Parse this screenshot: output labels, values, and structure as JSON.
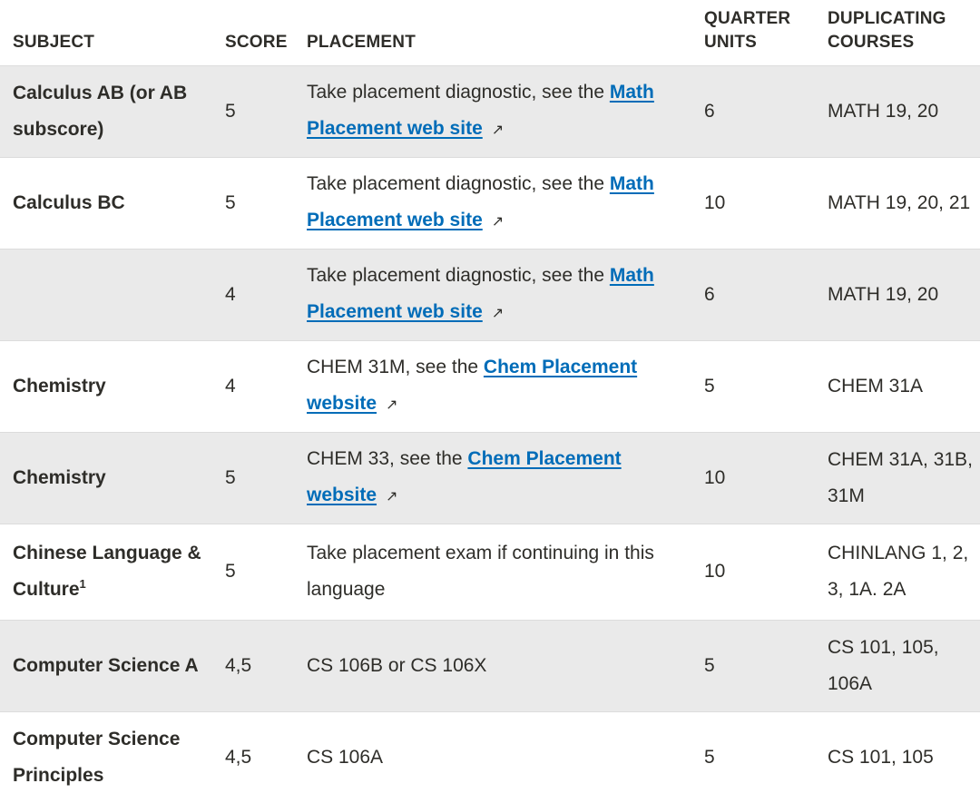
{
  "headers": {
    "subject": "SUBJECT",
    "score": "SCORE",
    "placement": "PLACEMENT",
    "units_line1": "QUARTER",
    "units_line2": "UNITS",
    "dup_line1": "DUPLICATING",
    "dup_line2": "COURSES"
  },
  "rows": [
    {
      "subject": "Calculus AB (or AB subscore)",
      "score": "5",
      "placement_prefix": "Take placement diagnostic, see the ",
      "placement_link": "Math Placement web site",
      "units": "6",
      "duplicating": "MATH 19, 20"
    },
    {
      "subject": "Calculus BC",
      "score": "5",
      "placement_prefix": "Take placement diagnostic, see the ",
      "placement_link": "Math Placement web site",
      "units": "10",
      "duplicating": "MATH 19, 20, 21"
    },
    {
      "subject": "",
      "score": "4",
      "placement_prefix": "Take placement diagnostic, see the ",
      "placement_link": "Math Placement web site",
      "units": "6",
      "duplicating": "MATH 19, 20"
    },
    {
      "subject": "Chemistry",
      "score": "4",
      "placement_prefix": "CHEM 31M, see the ",
      "placement_link": "Chem Placement website",
      "units": "5",
      "duplicating": "CHEM 31A"
    },
    {
      "subject": "Chemistry",
      "score": "5",
      "placement_prefix": "CHEM 33, see the ",
      "placement_link": "Chem Placement website",
      "units": "10",
      "duplicating": "CHEM 31A, 31B, 31M"
    },
    {
      "subject": "Chinese Language & Culture",
      "subject_sup": "1",
      "score": "5",
      "placement_text": "Take placement exam if continuing in this language",
      "units": "10",
      "duplicating": "CHINLANG 1, 2, 3, 1A. 2A"
    },
    {
      "subject": "Computer Science A",
      "score": "4,5",
      "placement_text": "CS 106B or CS 106X",
      "units": "5",
      "duplicating": "CS 101, 105, 106A"
    },
    {
      "subject": "Computer Science Principles",
      "score": "4,5",
      "placement_text": "CS 106A",
      "units": "5",
      "duplicating": "CS 101, 105"
    }
  ],
  "icons": {
    "external_link": "external-link-icon"
  },
  "colors": {
    "link": "#006cb8",
    "row_shade": "#eaeaea",
    "text": "#2e2d29"
  }
}
